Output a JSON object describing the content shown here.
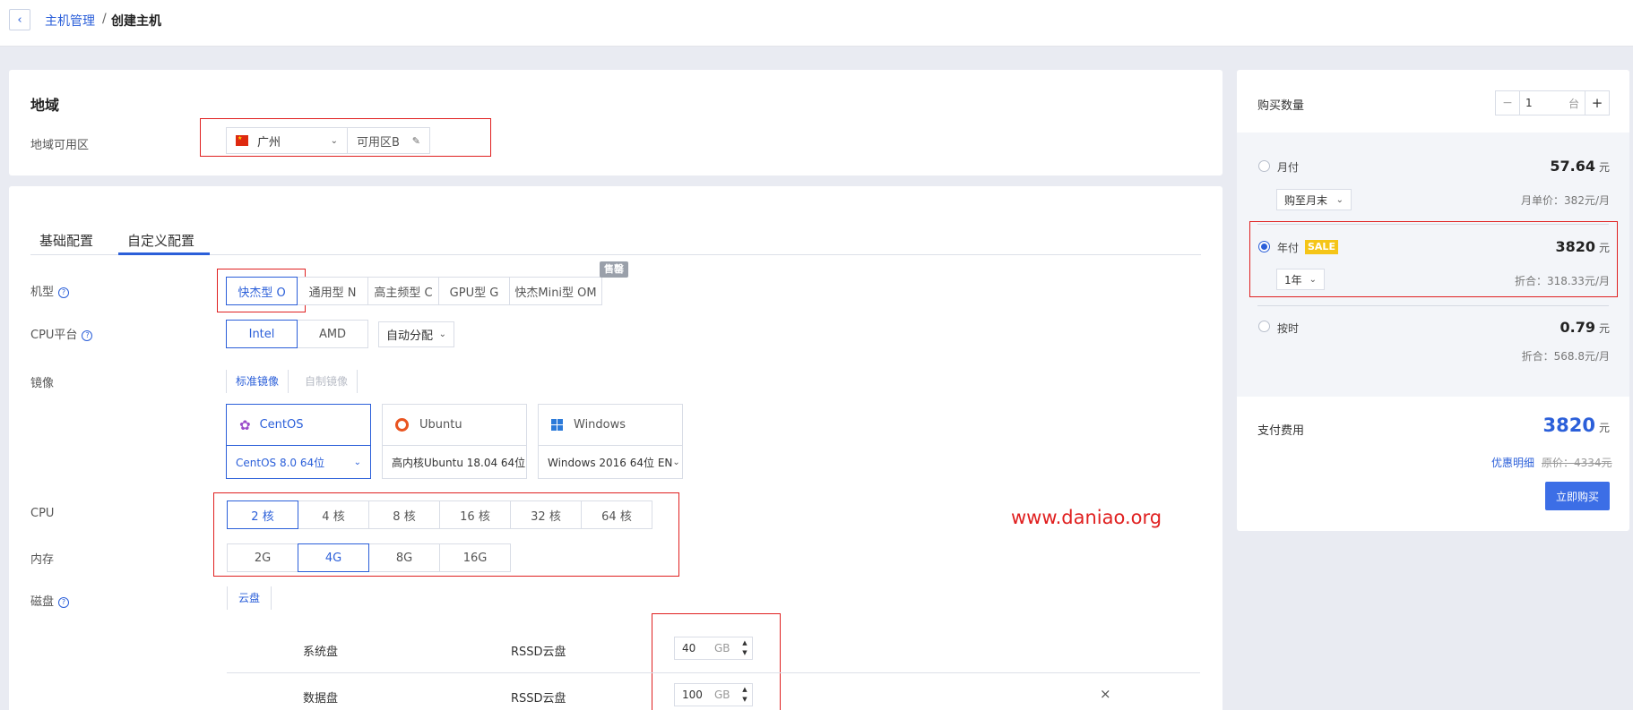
{
  "breadcrumb": {
    "back_icon": "chevron-left-icon",
    "parent": "主机管理",
    "separator": "/",
    "current": "创建主机"
  },
  "region": {
    "title": "地域",
    "zone_label": "地域可用区",
    "city": "广州",
    "zone": "可用区B"
  },
  "tabs": [
    {
      "label": "基础配置"
    },
    {
      "label": "自定义配置"
    }
  ],
  "machine_type": {
    "label": "机型",
    "options": [
      "快杰型 O",
      "通用型 N",
      "高主频型 C",
      "GPU型 G",
      "快杰Mini型 OM"
    ],
    "selected": "快杰型 O",
    "soldout_badge": "售罄"
  },
  "cpu_platform": {
    "label": "CPU平台",
    "options": [
      "Intel",
      "AMD"
    ],
    "selected": "Intel",
    "allocation": "自动分配"
  },
  "image": {
    "label": "镜像",
    "tabs": [
      "标准镜像",
      "自制镜像"
    ],
    "cards": [
      {
        "name": "CentOS",
        "version": "CentOS 8.0 64位"
      },
      {
        "name": "Ubuntu",
        "version": "高内核Ubuntu 18.04 64位"
      },
      {
        "name": "Windows",
        "version": "Windows 2016 64位 EN"
      }
    ]
  },
  "cpu": {
    "label": "CPU",
    "options": [
      "2 核",
      "4 核",
      "8 核",
      "16 核",
      "32 核",
      "64 核"
    ],
    "selected": "2 核"
  },
  "memory": {
    "label": "内存",
    "options": [
      "2G",
      "4G",
      "8G",
      "16G"
    ],
    "selected": "4G"
  },
  "disk": {
    "label": "磁盘",
    "tab": "云盘",
    "rows": [
      {
        "name": "系统盘",
        "type": "RSSD云盘",
        "size": "40",
        "unit": "GB"
      },
      {
        "name": "数据盘",
        "type": "RSSD云盘",
        "size": "100",
        "unit": "GB",
        "remove": "×"
      }
    ]
  },
  "watermark": "www.daniao.org",
  "purchase": {
    "qty_label": "购买数量",
    "qty_minus": "−",
    "qty_value": "1",
    "qty_unit": "台",
    "qty_plus": "+",
    "monthly": {
      "label": "月付",
      "price": "57.64",
      "currency": "元",
      "option": "购至月末",
      "note": "月单价：382元/月"
    },
    "yearly": {
      "label": "年付",
      "badge": "SALE",
      "price": "3820",
      "currency": "元",
      "option": "1年",
      "note": "折合：318.33元/月"
    },
    "hourly": {
      "label": "按时",
      "price": "0.79",
      "currency": "元",
      "note": "折合：568.8元/月"
    },
    "total_label": "支付费用",
    "total_price": "3820",
    "total_currency": "元",
    "discount_link": "优惠明细",
    "original_price": "原价：4334元",
    "buy_button": "立即购买"
  }
}
